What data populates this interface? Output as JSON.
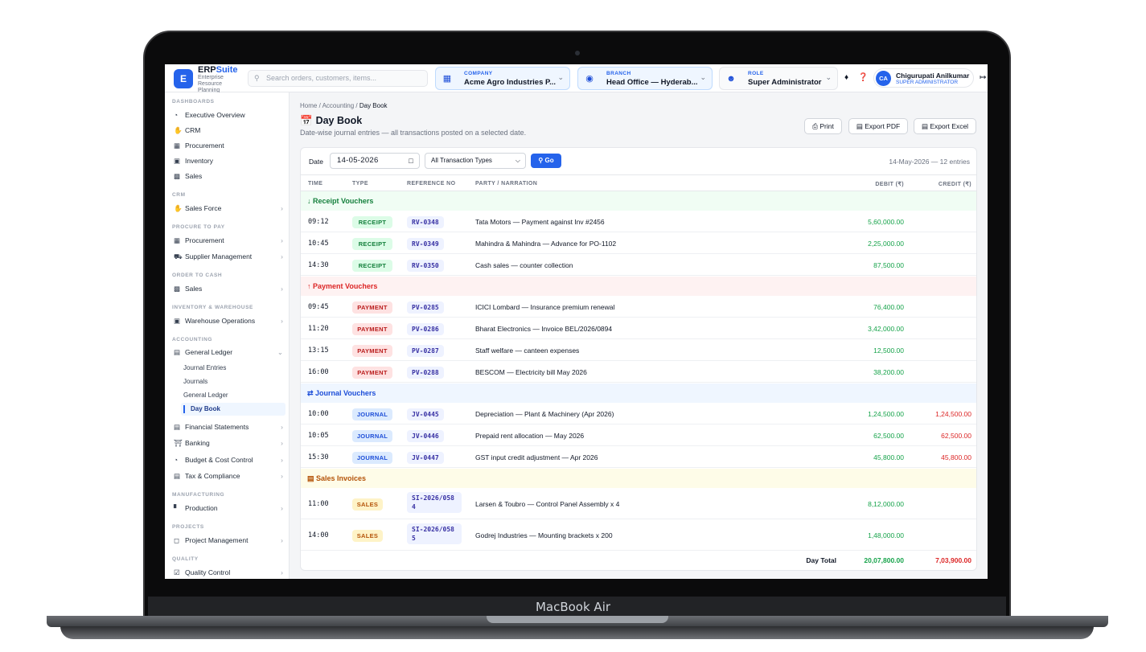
{
  "device": {
    "brand": "MacBook Air"
  },
  "app": {
    "logo_letter": "E",
    "name_a": "ERP",
    "name_b": "Suite",
    "subtitle": "Enterprise Resource Planning"
  },
  "search": {
    "placeholder": "Search orders, customers, items..."
  },
  "context": {
    "company": {
      "label": "COMPANY",
      "value": "Acme Agro Industries P..."
    },
    "branch": {
      "label": "BRANCH",
      "value": "Head Office — Hyderab..."
    },
    "role": {
      "label": "ROLE",
      "value": "Super Administrator"
    }
  },
  "user": {
    "initials": "CA",
    "name": "Chigurupati Anilkumar",
    "role": "SUPER ADMINISTRATOR"
  },
  "sidebar": {
    "sections": [
      {
        "title": "DASHBOARDS"
      },
      {
        "title": "CRM"
      },
      {
        "title": "PROCURE TO PAY"
      },
      {
        "title": "ORDER TO CASH"
      },
      {
        "title": "INVENTORY & WAREHOUSE"
      },
      {
        "title": "ACCOUNTING"
      },
      {
        "title": "MANUFACTURING"
      },
      {
        "title": "PROJECTS"
      },
      {
        "title": "QUALITY"
      }
    ],
    "items": [
      {
        "label": "Executive Overview",
        "icon": "gauge-icon"
      },
      {
        "label": "CRM",
        "icon": "handshake-icon"
      },
      {
        "label": "Procurement",
        "icon": "procurement-icon"
      },
      {
        "label": "Inventory",
        "icon": "warehouse-icon"
      },
      {
        "label": "Sales",
        "icon": "cash-register-icon"
      },
      {
        "label": "Sales Force",
        "icon": "handshake-icon"
      },
      {
        "label": "Procurement",
        "icon": "procurement-icon"
      },
      {
        "label": "Supplier Management",
        "icon": "truck-icon"
      },
      {
        "label": "Sales",
        "icon": "cash-register-icon"
      },
      {
        "label": "Warehouse Operations",
        "icon": "warehouse-icon"
      },
      {
        "label": "General Ledger",
        "icon": "book-icon"
      },
      {
        "label": "Financial Statements",
        "icon": "file-icon"
      },
      {
        "label": "Banking",
        "icon": "bank-icon"
      },
      {
        "label": "Budget & Cost Control",
        "icon": "chart-pie-icon"
      },
      {
        "label": "Tax & Compliance",
        "icon": "file-icon"
      },
      {
        "label": "Production",
        "icon": "factory-icon"
      },
      {
        "label": "Project Management",
        "icon": "sitemap-icon"
      },
      {
        "label": "Quality Control",
        "icon": "clipboard-check-icon"
      }
    ],
    "gl_sub": [
      "Journal Entries",
      "Journals",
      "General Ledger",
      "Day Book"
    ]
  },
  "breadcrumb": {
    "home": "Home",
    "accounting": "Accounting",
    "current": "Day Book"
  },
  "page": {
    "title": "Day Book",
    "subtitle": "Date-wise journal entries — all transactions posted on a selected date."
  },
  "actions": {
    "print": "Print",
    "export_pdf": "Export PDF",
    "export_excel": "Export Excel"
  },
  "filters": {
    "date_label": "Date",
    "date_value": "14-05-2026",
    "type_value": "All Transaction Types",
    "go": "Go",
    "summary": "14-May-2026 — 12 entries"
  },
  "columns": {
    "time": "TIME",
    "type": "TYPE",
    "ref": "REFERENCE NO",
    "party": "PARTY / NARRATION",
    "debit": "DEBIT (₹)",
    "credit": "CREDIT (₹)"
  },
  "groups": [
    {
      "title": "Receipt Vouchers",
      "color": "#15803d",
      "bg": "#f0fdf4",
      "rows": [
        {
          "time": "09:12",
          "type": "RECEIPT",
          "ref": "RV-0348",
          "party": "Tata Motors — Payment against Inv #2456",
          "debit": "5,60,000.00",
          "credit": ""
        },
        {
          "time": "10:45",
          "type": "RECEIPT",
          "ref": "RV-0349",
          "party": "Mahindra & Mahindra — Advance for PO-1102",
          "debit": "2,25,000.00",
          "credit": ""
        },
        {
          "time": "14:30",
          "type": "RECEIPT",
          "ref": "RV-0350",
          "party": "Cash sales — counter collection",
          "debit": "87,500.00",
          "credit": ""
        }
      ]
    },
    {
      "title": "Payment Vouchers",
      "color": "#dc2626",
      "bg": "#fef2f2",
      "rows": [
        {
          "time": "09:45",
          "type": "PAYMENT",
          "ref": "PV-0285",
          "party": "ICICI Lombard — Insurance premium renewal",
          "debit": "76,400.00",
          "credit": ""
        },
        {
          "time": "11:20",
          "type": "PAYMENT",
          "ref": "PV-0286",
          "party": "Bharat Electronics — Invoice BEL/2026/0894",
          "debit": "3,42,000.00",
          "credit": ""
        },
        {
          "time": "13:15",
          "type": "PAYMENT",
          "ref": "PV-0287",
          "party": "Staff welfare — canteen expenses",
          "debit": "12,500.00",
          "credit": ""
        },
        {
          "time": "16:00",
          "type": "PAYMENT",
          "ref": "PV-0288",
          "party": "BESCOM — Electricity bill May 2026",
          "debit": "38,200.00",
          "credit": ""
        }
      ]
    },
    {
      "title": "Journal Vouchers",
      "color": "#1d4ed8",
      "bg": "#eff6ff",
      "rows": [
        {
          "time": "10:00",
          "type": "JOURNAL",
          "ref": "JV-0445",
          "party": "Depreciation — Plant & Machinery (Apr 2026)",
          "debit": "1,24,500.00",
          "credit": "1,24,500.00"
        },
        {
          "time": "10:05",
          "type": "JOURNAL",
          "ref": "JV-0446",
          "party": "Prepaid rent allocation — May 2026",
          "debit": "62,500.00",
          "credit": "62,500.00"
        },
        {
          "time": "15:30",
          "type": "JOURNAL",
          "ref": "JV-0447",
          "party": "GST input credit adjustment — Apr 2026",
          "debit": "45,800.00",
          "credit": "45,800.00"
        }
      ]
    },
    {
      "title": "Sales Invoices",
      "color": "#b45309",
      "bg": "#fefce8",
      "rows": [
        {
          "time": "11:00",
          "type": "SALES",
          "ref": "SI-2026/0584",
          "party": "Larsen & Toubro — Control Panel Assembly x 4",
          "debit": "8,12,000.00",
          "credit": ""
        },
        {
          "time": "14:00",
          "type": "SALES",
          "ref": "SI-2026/0585",
          "party": "Godrej Industries — Mounting brackets x 200",
          "debit": "1,48,000.00",
          "credit": ""
        }
      ]
    }
  ],
  "totals": {
    "label": "Day Total",
    "debit": "20,07,800.00",
    "credit": "7,03,900.00"
  },
  "badge_colors": {
    "RECEIPT": {
      "bg": "#dcfce7",
      "fg": "#15803d"
    },
    "PAYMENT": {
      "bg": "#fee2e2",
      "fg": "#b91c1c"
    },
    "JOURNAL": {
      "bg": "#dbeafe",
      "fg": "#1d4ed8"
    },
    "SALES": {
      "bg": "#fef3c7",
      "fg": "#b45309"
    }
  },
  "group_icons": [
    "arrow-down-icon",
    "arrow-up-icon",
    "exchange-icon",
    "file-invoice-icon"
  ]
}
